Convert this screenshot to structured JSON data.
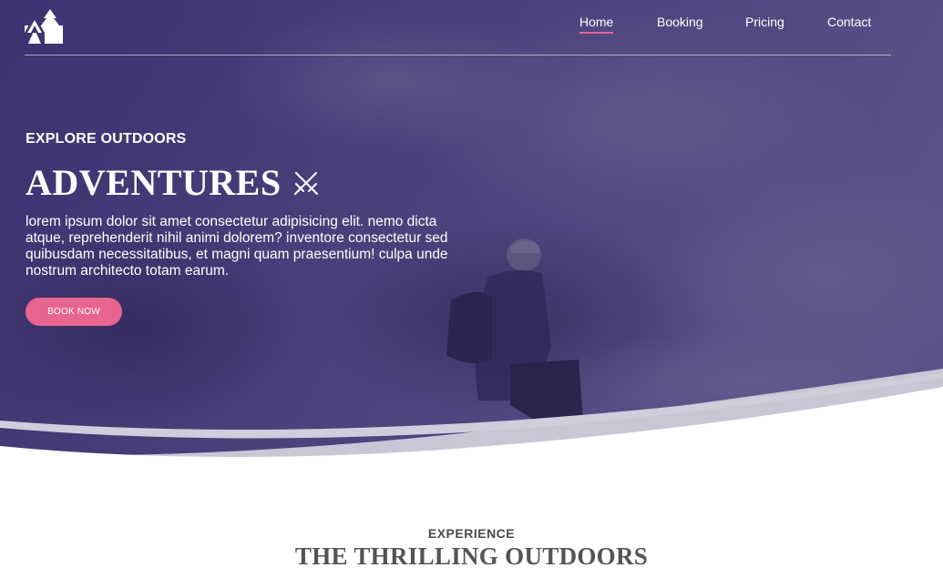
{
  "colors": {
    "hero_overlay": "#3f3472",
    "accent": "#e8658f",
    "text_light": "#ffffff",
    "text_dark": "#545454"
  },
  "brand": {
    "logo_icon": "tent-tree-icon"
  },
  "nav": {
    "items": [
      {
        "label": "Home",
        "active": true
      },
      {
        "label": "Booking",
        "active": false
      },
      {
        "label": "Pricing",
        "active": false
      },
      {
        "label": "Contact",
        "active": false
      }
    ]
  },
  "hero": {
    "eyebrow": "EXPLORE OUTDOORS",
    "headline": "ADVENTURES",
    "headline_icon": "crossed-swords-icon",
    "body": "lorem ipsum dolor sit amet consectetur adipisicing elit. nemo dicta atque, reprehenderit nihil animi dolorem? inventore consectetur sed quibusdam necessitatibus, et magni quam praesentium! culpa unde nostrum architecto totam earum.",
    "cta_label": "BOOK NOW"
  },
  "section": {
    "eyebrow": "EXPERIENCE",
    "title": "THE THRILLING OUTDOORS"
  }
}
